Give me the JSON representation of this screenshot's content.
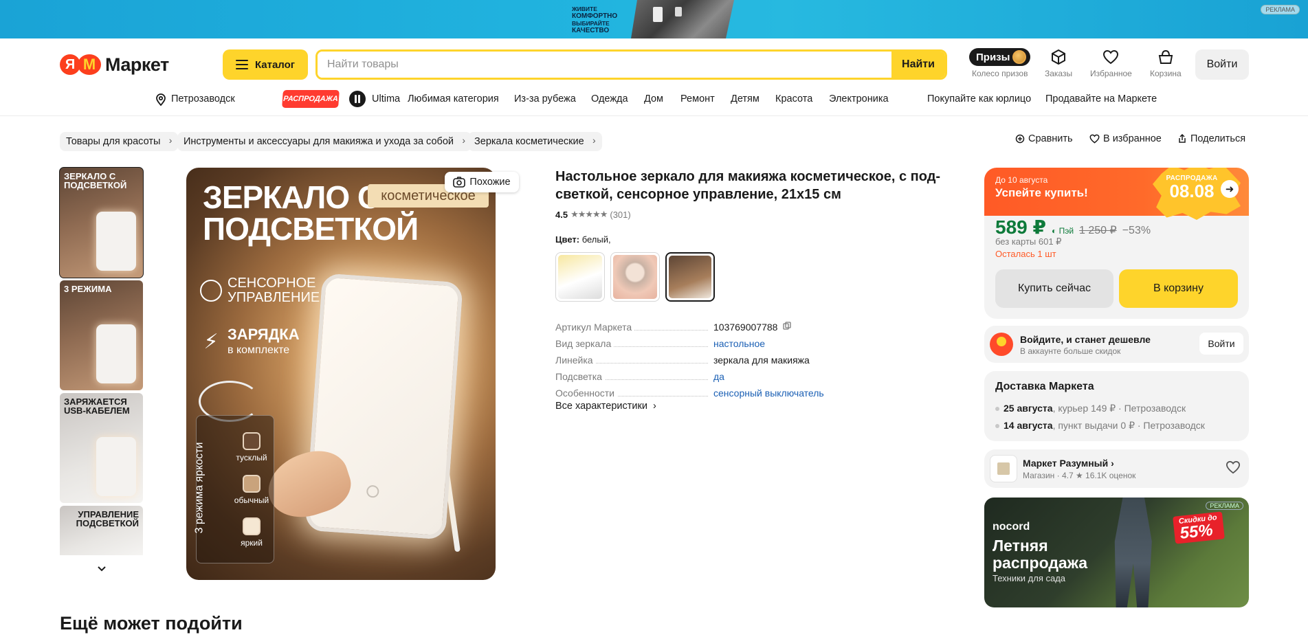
{
  "ad_banner": {
    "lines": [
      "живите",
      "комфортно",
      "выбирайте",
      "качество"
    ],
    "label": "РЕКЛАМА"
  },
  "header": {
    "logo_text": "Маркет",
    "logo_letter_ya": "Я",
    "logo_letter_m": "М",
    "catalog_label": "Каталог",
    "search_placeholder": "Найти товары",
    "search_button": "Найти",
    "prizes_pill": "Призы",
    "prizes_label": "Колесо призов",
    "orders_label": "Заказы",
    "favorites_label": "Избранное",
    "cart_label": "Корзина",
    "login_label": "Войти"
  },
  "nav": {
    "city": "Петрозаводск",
    "sale_badge": "РАСПРОДАЖА",
    "items": [
      "Ultima",
      "Любимая категория",
      "Из-за рубежа",
      "Одежда",
      "Дом",
      "Ремонт",
      "Детям",
      "Красота",
      "Электроника"
    ],
    "right_items": [
      "Покупайте как юрлицо",
      "Продавайте на Маркете"
    ]
  },
  "breadcrumbs": [
    "Товары для красоты",
    "Инструменты и аксессуары для макияжа и ухода за собой",
    "Зеркала косметические"
  ],
  "top_actions": [
    "Сравнить",
    "В избранное",
    "Поделиться"
  ],
  "gallery": {
    "thumbs": [
      {
        "title": "Зеркало с подсветкой"
      },
      {
        "title": "3 режима"
      },
      {
        "title": "Заряжается USB-кабелем"
      },
      {
        "title": "Управление подсветкой"
      }
    ],
    "main_title": "Зеркало с подсветкой",
    "main_chip": "косметическое",
    "feature_1": "Сенсорное управление",
    "feature_2_bold": "Зарядка",
    "feature_2_small": "в комплекте",
    "brightness_caption": "3 режима яркости",
    "brightness_modes": [
      "тусклый",
      "обычный",
      "яркий"
    ],
    "similar_button": "Похожие"
  },
  "product": {
    "title": "Настольное зеркало для макияжа косметическое, с под-светкой, сенсорное управление, 21x15 см",
    "rating_value": "4.5",
    "rating_stars": "★★★★★",
    "rating_count": "(301)",
    "color_label": "Цвет:",
    "color_value": "белый,",
    "specs": [
      {
        "key": "Артикул Маркета",
        "value": "103769007788"
      },
      {
        "key": "Вид зеркала",
        "value": "настольное"
      },
      {
        "key": "Линейка",
        "value": "зеркала для макияжа"
      },
      {
        "key": "Подсветка",
        "value": "да"
      },
      {
        "key": "Особенности",
        "value": "сенсорный выключатель"
      }
    ],
    "all_specs": "Все характеристики"
  },
  "buy_card": {
    "until": "До 10 августа",
    "hurry": "Успейте купить!",
    "promo_small": "РАСПРОДАЖА",
    "promo_date": "08.08",
    "price": "589 ₽",
    "pay_label": "Пэй",
    "old_price": "1 250 ₽",
    "discount": "−53%",
    "no_card": "без карты 601 ₽",
    "left_stock": "Осталась 1 шт",
    "buy_now": "Купить сейчас",
    "to_cart": "В корзину"
  },
  "login_card": {
    "title": "Войдите, и станет дешевле",
    "subtitle": "В аккаунте больше скидок",
    "button": "Войти"
  },
  "delivery": {
    "title": "Доставка Маркета",
    "items": [
      {
        "date": "25 августа",
        "rest": ", курьер 149 ₽ · Петрозаводск"
      },
      {
        "date": "14 августа",
        "rest": ", пункт выдачи 0 ₽ · Петрозаводск"
      }
    ]
  },
  "seller": {
    "name": "Маркет Разумный ›",
    "meta": "Магазин · 4.7 ★ 16.1K оценок"
  },
  "ad_card": {
    "brand": "nocord",
    "headline_1": "Летняя",
    "headline_2": "распродажа",
    "subtitle": "Техники для сада",
    "sale_small": "Скидки до",
    "sale_big": "55%",
    "label": "РЕКЛАМА"
  },
  "more_title": "Ещё может подойти"
}
